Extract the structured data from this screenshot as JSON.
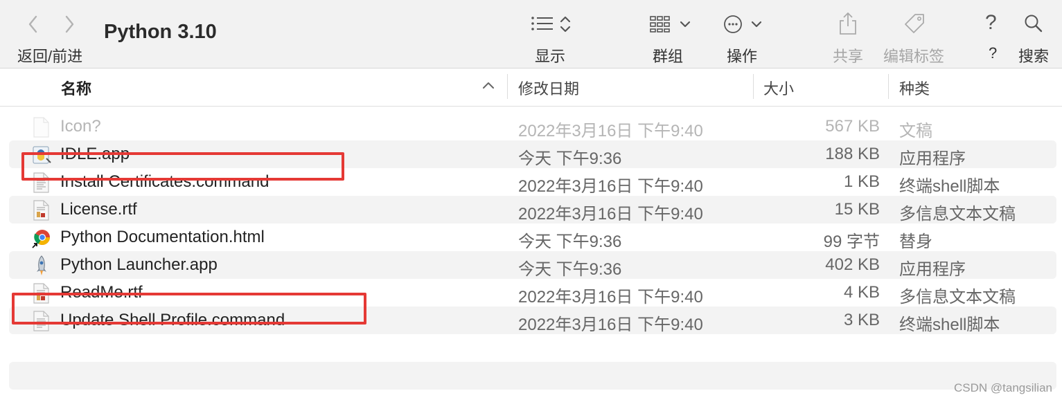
{
  "toolbar": {
    "back_forward_label": "返回/前进",
    "window_title": "Python 3.10",
    "view_label": "显示",
    "group_label": "群组",
    "action_label": "操作",
    "share_label": "共享",
    "tags_label": "编辑标签",
    "help_label": "?",
    "search_label": "搜索",
    "icons": [
      "chevron-left-icon",
      "chevron-right-icon",
      "list-view-icon",
      "grid-group-icon",
      "more-actions-icon",
      "share-icon",
      "tag-icon",
      "help-icon",
      "search-icon"
    ]
  },
  "columns": {
    "name": "名称",
    "date": "修改日期",
    "size": "大小",
    "kind": "种类"
  },
  "files": [
    {
      "name": "Icon?",
      "date": "2022年3月16日 下午9:40",
      "size": "567 KB",
      "kind": "文稿",
      "icon": "blank-document-icon",
      "dimmed": true
    },
    {
      "name": "IDLE.app",
      "date": "今天 下午9:36",
      "size": "188 KB",
      "kind": "应用程序",
      "icon": "idle-app-icon"
    },
    {
      "name": "Install Certificates.command",
      "date": "2022年3月16日 下午9:40",
      "size": "1 KB",
      "kind": "终端shell脚本",
      "icon": "script-document-icon",
      "highlighted": true
    },
    {
      "name": "License.rtf",
      "date": "2022年3月16日 下午9:40",
      "size": "15 KB",
      "kind": "多信息文本文稿",
      "icon": "rtf-document-icon"
    },
    {
      "name": "Python Documentation.html",
      "date": "今天 下午9:36",
      "size": "99 字节",
      "kind": "替身",
      "icon": "chrome-alias-icon"
    },
    {
      "name": "Python Launcher.app",
      "date": "今天 下午9:36",
      "size": "402 KB",
      "kind": "应用程序",
      "icon": "rocket-app-icon"
    },
    {
      "name": "ReadMe.rtf",
      "date": "2022年3月16日 下午9:40",
      "size": "4 KB",
      "kind": "多信息文本文稿",
      "icon": "rtf-document-icon"
    },
    {
      "name": "Update Shell Profile.command",
      "date": "2022年3月16日 下午9:40",
      "size": "3 KB",
      "kind": "终端shell脚本",
      "icon": "script-document-icon",
      "highlighted": true
    }
  ],
  "watermark": "CSDN @tangsilian",
  "colors": {
    "highlight": "#e53935",
    "stripe": "#f3f3f3",
    "toolbar": "#f2f2f2"
  }
}
